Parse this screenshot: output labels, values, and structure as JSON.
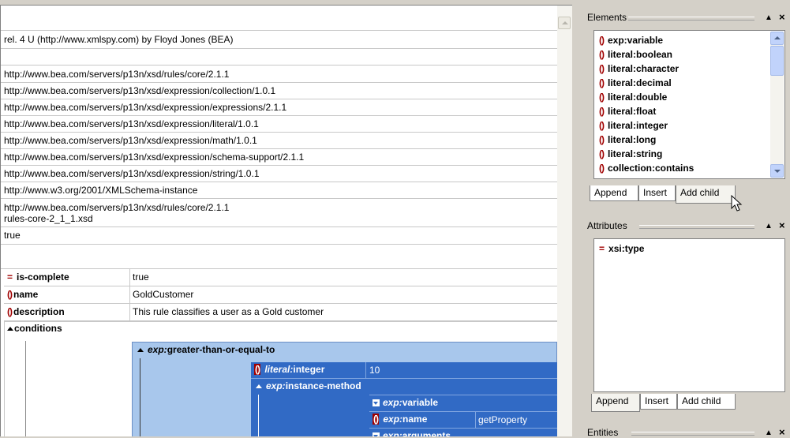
{
  "editor": {
    "header_text": "rel. 4 U (http://www.xmlspy.com) by Floyd Jones (BEA)",
    "namespace_rows": [
      "http://www.bea.com/servers/p13n/xsd/rules/core/2.1.1",
      "http://www.bea.com/servers/p13n/xsd/expression/collection/1.0.1",
      "http://www.bea.com/servers/p13n/xsd/expression/expressions/2.1.1",
      "http://www.bea.com/servers/p13n/xsd/expression/literal/1.0.1",
      "http://www.bea.com/servers/p13n/xsd/expression/math/1.0.1",
      "http://www.bea.com/servers/p13n/xsd/expression/schema-support/2.1.1",
      "http://www.bea.com/servers/p13n/xsd/expression/string/1.0.1",
      "http://www.w3.org/2001/XMLSchema-instance"
    ],
    "schema_location_line1": "http://www.bea.com/servers/p13n/xsd/rules/core/2.1.1",
    "schema_location_line2": "rules-core-2_1_1.xsd",
    "bool_value": "true",
    "attrs": [
      {
        "icon": "=",
        "name": "is-complete",
        "value": "true"
      },
      {
        "icon": "()",
        "name": "name",
        "value": "GoldCustomer"
      },
      {
        "icon": "()",
        "name": "description",
        "value": "This rule classifies a user as a Gold customer"
      }
    ],
    "conditions_label": "conditions",
    "gte_prefix": "exp:",
    "gte_name": "greater-than-or-equal-to",
    "literal_prefix": "literal:",
    "literal_name": "integer",
    "literal_value": "10",
    "instance_method_prefix": "exp:",
    "instance_method_name": "instance-method",
    "sub_variable_prefix": "exp:",
    "sub_variable_name": "variable",
    "sub_name_prefix": "exp:",
    "sub_name_name": "name",
    "sub_name_value": "getProperty",
    "sub_args_prefix": "exp:",
    "sub_args_name": "arguments"
  },
  "elements_panel": {
    "title": "Elements",
    "items": [
      "exp:variable",
      "literal:boolean",
      "literal:character",
      "literal:decimal",
      "literal:double",
      "literal:float",
      "literal:integer",
      "literal:long",
      "literal:string",
      "collection:contains"
    ],
    "tabs": [
      "Append",
      "Insert",
      "Add child"
    ]
  },
  "attributes_panel": {
    "title": "Attributes",
    "items": [
      "xsi:type"
    ],
    "tabs": [
      "Append",
      "Insert",
      "Add child"
    ]
  },
  "entities_panel": {
    "title": "Entities"
  },
  "panel_controls": {
    "pin": "▲",
    "close": "×"
  }
}
